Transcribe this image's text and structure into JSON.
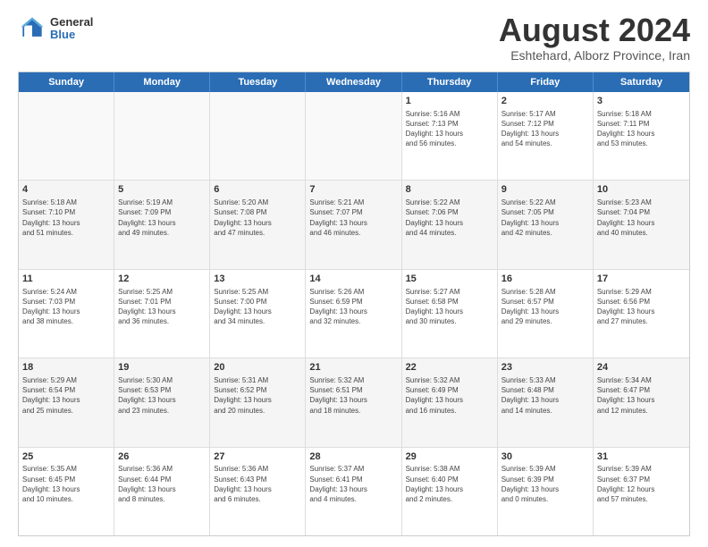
{
  "logo": {
    "general": "General",
    "blue": "Blue"
  },
  "title": "August 2024",
  "subtitle": "Eshtehard, Alborz Province, Iran",
  "weekdays": [
    "Sunday",
    "Monday",
    "Tuesday",
    "Wednesday",
    "Thursday",
    "Friday",
    "Saturday"
  ],
  "rows": [
    [
      {
        "day": "",
        "info": ""
      },
      {
        "day": "",
        "info": ""
      },
      {
        "day": "",
        "info": ""
      },
      {
        "day": "",
        "info": ""
      },
      {
        "day": "1",
        "info": "Sunrise: 5:16 AM\nSunset: 7:13 PM\nDaylight: 13 hours\nand 56 minutes."
      },
      {
        "day": "2",
        "info": "Sunrise: 5:17 AM\nSunset: 7:12 PM\nDaylight: 13 hours\nand 54 minutes."
      },
      {
        "day": "3",
        "info": "Sunrise: 5:18 AM\nSunset: 7:11 PM\nDaylight: 13 hours\nand 53 minutes."
      }
    ],
    [
      {
        "day": "4",
        "info": "Sunrise: 5:18 AM\nSunset: 7:10 PM\nDaylight: 13 hours\nand 51 minutes."
      },
      {
        "day": "5",
        "info": "Sunrise: 5:19 AM\nSunset: 7:09 PM\nDaylight: 13 hours\nand 49 minutes."
      },
      {
        "day": "6",
        "info": "Sunrise: 5:20 AM\nSunset: 7:08 PM\nDaylight: 13 hours\nand 47 minutes."
      },
      {
        "day": "7",
        "info": "Sunrise: 5:21 AM\nSunset: 7:07 PM\nDaylight: 13 hours\nand 46 minutes."
      },
      {
        "day": "8",
        "info": "Sunrise: 5:22 AM\nSunset: 7:06 PM\nDaylight: 13 hours\nand 44 minutes."
      },
      {
        "day": "9",
        "info": "Sunrise: 5:22 AM\nSunset: 7:05 PM\nDaylight: 13 hours\nand 42 minutes."
      },
      {
        "day": "10",
        "info": "Sunrise: 5:23 AM\nSunset: 7:04 PM\nDaylight: 13 hours\nand 40 minutes."
      }
    ],
    [
      {
        "day": "11",
        "info": "Sunrise: 5:24 AM\nSunset: 7:03 PM\nDaylight: 13 hours\nand 38 minutes."
      },
      {
        "day": "12",
        "info": "Sunrise: 5:25 AM\nSunset: 7:01 PM\nDaylight: 13 hours\nand 36 minutes."
      },
      {
        "day": "13",
        "info": "Sunrise: 5:25 AM\nSunset: 7:00 PM\nDaylight: 13 hours\nand 34 minutes."
      },
      {
        "day": "14",
        "info": "Sunrise: 5:26 AM\nSunset: 6:59 PM\nDaylight: 13 hours\nand 32 minutes."
      },
      {
        "day": "15",
        "info": "Sunrise: 5:27 AM\nSunset: 6:58 PM\nDaylight: 13 hours\nand 30 minutes."
      },
      {
        "day": "16",
        "info": "Sunrise: 5:28 AM\nSunset: 6:57 PM\nDaylight: 13 hours\nand 29 minutes."
      },
      {
        "day": "17",
        "info": "Sunrise: 5:29 AM\nSunset: 6:56 PM\nDaylight: 13 hours\nand 27 minutes."
      }
    ],
    [
      {
        "day": "18",
        "info": "Sunrise: 5:29 AM\nSunset: 6:54 PM\nDaylight: 13 hours\nand 25 minutes."
      },
      {
        "day": "19",
        "info": "Sunrise: 5:30 AM\nSunset: 6:53 PM\nDaylight: 13 hours\nand 23 minutes."
      },
      {
        "day": "20",
        "info": "Sunrise: 5:31 AM\nSunset: 6:52 PM\nDaylight: 13 hours\nand 20 minutes."
      },
      {
        "day": "21",
        "info": "Sunrise: 5:32 AM\nSunset: 6:51 PM\nDaylight: 13 hours\nand 18 minutes."
      },
      {
        "day": "22",
        "info": "Sunrise: 5:32 AM\nSunset: 6:49 PM\nDaylight: 13 hours\nand 16 minutes."
      },
      {
        "day": "23",
        "info": "Sunrise: 5:33 AM\nSunset: 6:48 PM\nDaylight: 13 hours\nand 14 minutes."
      },
      {
        "day": "24",
        "info": "Sunrise: 5:34 AM\nSunset: 6:47 PM\nDaylight: 13 hours\nand 12 minutes."
      }
    ],
    [
      {
        "day": "25",
        "info": "Sunrise: 5:35 AM\nSunset: 6:45 PM\nDaylight: 13 hours\nand 10 minutes."
      },
      {
        "day": "26",
        "info": "Sunrise: 5:36 AM\nSunset: 6:44 PM\nDaylight: 13 hours\nand 8 minutes."
      },
      {
        "day": "27",
        "info": "Sunrise: 5:36 AM\nSunset: 6:43 PM\nDaylight: 13 hours\nand 6 minutes."
      },
      {
        "day": "28",
        "info": "Sunrise: 5:37 AM\nSunset: 6:41 PM\nDaylight: 13 hours\nand 4 minutes."
      },
      {
        "day": "29",
        "info": "Sunrise: 5:38 AM\nSunset: 6:40 PM\nDaylight: 13 hours\nand 2 minutes."
      },
      {
        "day": "30",
        "info": "Sunrise: 5:39 AM\nSunset: 6:39 PM\nDaylight: 13 hours\nand 0 minutes."
      },
      {
        "day": "31",
        "info": "Sunrise: 5:39 AM\nSunset: 6:37 PM\nDaylight: 12 hours\nand 57 minutes."
      }
    ]
  ]
}
